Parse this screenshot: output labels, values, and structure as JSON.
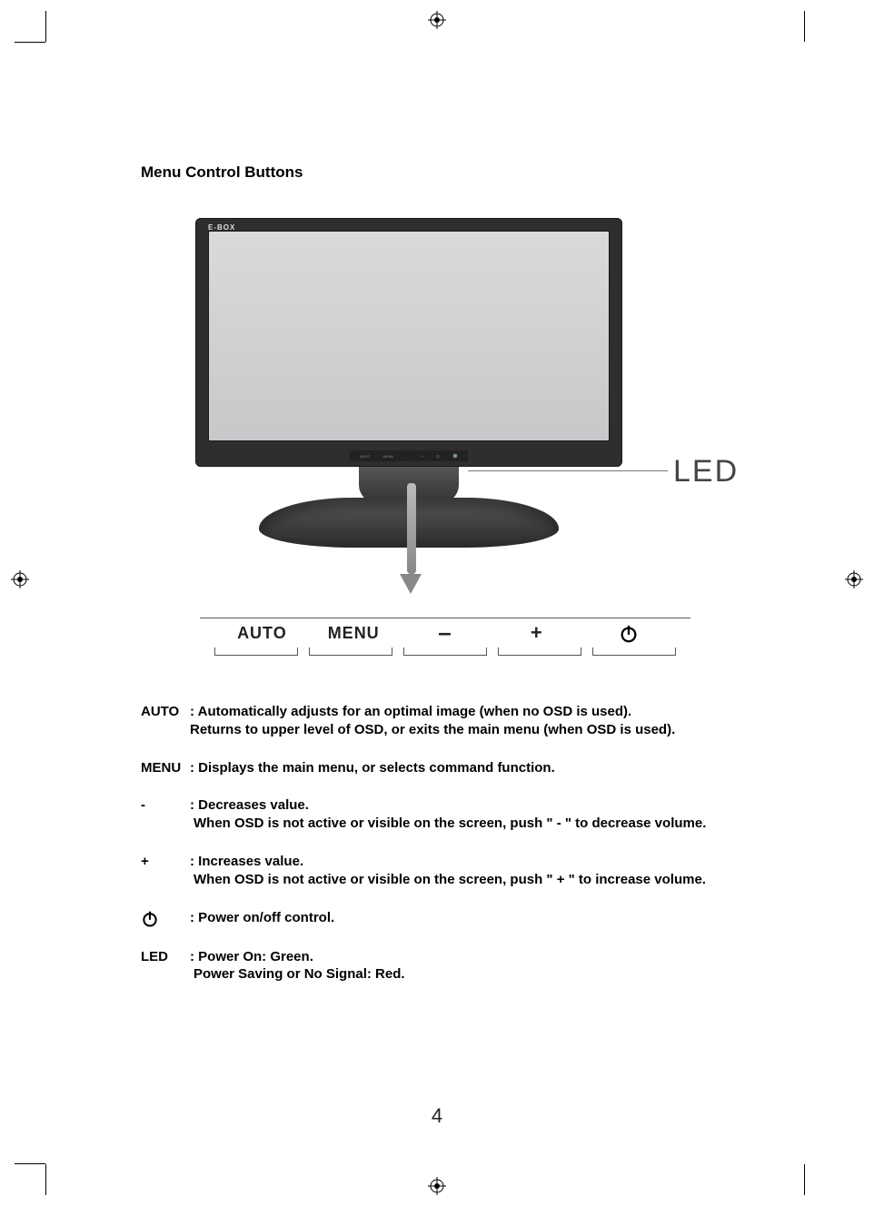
{
  "title": "Menu Control Buttons",
  "brand": "E-BOX",
  "led_callout": "LED",
  "button_row": {
    "auto": "AUTO",
    "menu": "MENU",
    "minus": "–",
    "plus": "+"
  },
  "descriptions": {
    "auto": {
      "key": "AUTO",
      "line1": ": Automatically adjusts for an optimal image (when no OSD is used).",
      "line2": "Returns to upper level of OSD, or exits the main menu (when OSD is used)."
    },
    "menu": {
      "key": "MENU",
      "text": ": Displays the main menu, or selects command function."
    },
    "minus": {
      "key": "-",
      "line1": ": Decreases value.",
      "line2": "When OSD is not active or visible on the screen, push \" - \" to decrease volume."
    },
    "plus": {
      "key": "+",
      "line1": ": Increases value.",
      "line2": "When OSD is not active or visible on the screen, push \" + \" to increase volume."
    },
    "power": {
      "text": ": Power on/off control."
    },
    "led": {
      "key": "LED",
      "line1": ": Power On: Green.",
      "line2": "Power Saving or No Signal: Red."
    }
  },
  "page_number": "4"
}
